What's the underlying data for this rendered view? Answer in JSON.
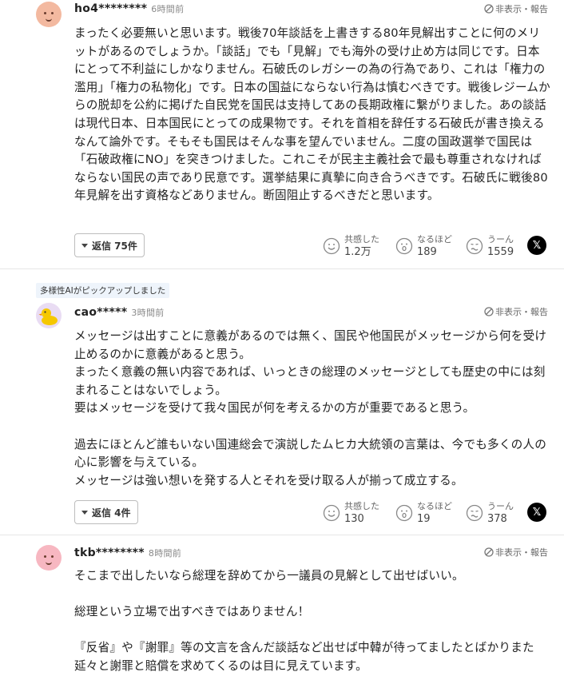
{
  "comments": [
    {
      "username": "ho4********",
      "time": "6時間前",
      "hide_report": "非表示・報告",
      "body": "まったく必要無いと思います。戦後70年談話を上書きする80年見解出すことに何のメリットがあるのでしょうか。「談話」でも「見解」でも海外の受け止め方は同じです。日本にとって不利益にしかなりません。石破氏のレガシーの為の行為であり、これは「権力の濫用」「権力の私物化」です。日本の国益にならない行為は慎むべきです。戦後レジームからの脱却を公約に掲げた自民党を国民は支持してあの長期政権に繋がりました。あの談話は現代日本、日本国民にとっての成果物です。それを首相を辞任する石破氏が書き換えるなんて論外です。そもそも国民はそんな事を望んでいません。二度の国政選挙で国民は「石破政権にNO」を突きつけました。これこそが民主主義社会で最も尊重されなければならない国民の声であり民意です。選挙結果に真摯に向き合うべきです。石破氏に戦後80年見解を出す資格などありません。断固阻止するべきだと思います。",
      "reply_label": "返信 75件",
      "reactions": [
        {
          "label": "共感した",
          "count": "1.2万"
        },
        {
          "label": "なるほど",
          "count": "189"
        },
        {
          "label": "うーん",
          "count": "1559"
        }
      ]
    },
    {
      "ai_badge": "多様性AIがピックアップしました",
      "username": "cao*****",
      "time": "3時間前",
      "hide_report": "非表示・報告",
      "body": "メッセージは出すことに意義があるのでは無く、国民や他国民がメッセージから何を受け止めるのかに意義があると思う。\nまったく意義の無い内容であれば、いっときの総理のメッセージとしても歴史の中には刻まれることはないでしょう。\n要はメッセージを受けて我々国民が何を考えるかの方が重要であると思う。\n\n過去にほとんど誰もいない国連総会で演説したムヒカ大統領の言葉は、今でも多くの人の心に影響を与えている。\nメッセージは強い想いを発する人とそれを受け取る人が揃って成立する。",
      "reply_label": "返信 4件",
      "reactions": [
        {
          "label": "共感した",
          "count": "130"
        },
        {
          "label": "なるほど",
          "count": "19"
        },
        {
          "label": "うーん",
          "count": "378"
        }
      ]
    },
    {
      "username": "tkb********",
      "time": "8時間前",
      "hide_report": "非表示・報告",
      "body": "そこまで出したいなら総理を辞めてから一議員の見解として出せばいい。\n\n総理という立場で出すべきではありません！\n\n『反省』や『謝罪』等の文言を含んだ談話など出せば中韓が待ってましたとばかりまた延々と謝罪と賠償を求めてくるのは目に見えています。"
    }
  ],
  "share": {
    "x_label": "𝕏"
  },
  "colors": {
    "text": "#222222",
    "muted": "#888888",
    "border": "#e6e6e6",
    "ai_badge_bg": "#eef4fb"
  }
}
